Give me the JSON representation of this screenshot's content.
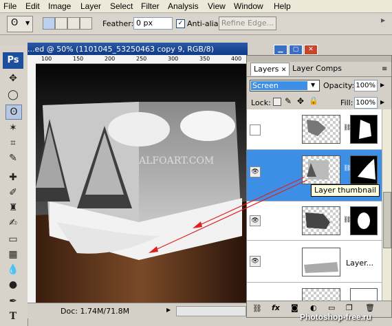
{
  "menu": [
    "File",
    "Edit",
    "Image",
    "Layer",
    "Select",
    "Filter",
    "Analysis",
    "View",
    "Window",
    "Help"
  ],
  "options": {
    "feather_label": "Feather:",
    "feather_value": "0 px",
    "antialias_label": "Anti-alias",
    "refine_edge_label": "Refine Edge..."
  },
  "tools": {
    "ps_logo": "Ps"
  },
  "document": {
    "title": "...ed @ 50% (1101045_53250463 copy 9, RGB/8)",
    "ruler_ticks": [
      "100",
      "150",
      "200",
      "250",
      "300",
      "350",
      "400"
    ],
    "doc_size": "Doc: 1.74M/71.8M",
    "image_watermark": "ALFOART.COM"
  },
  "layers_panel": {
    "tabs": [
      "Layers",
      "Layer Comps"
    ],
    "blend_mode": "Screen",
    "opacity_label": "Opacity:",
    "opacity_value": "100%",
    "lock_label": "Lock:",
    "fill_label": "Fill:",
    "fill_value": "100%",
    "layer_label": "Layer...",
    "tooltip": "Layer thumbnail"
  },
  "watermark": "Photoshop-free.ru",
  "colors": {
    "selection": "#3d8fe6",
    "title_bar": "#0f3a87",
    "arrow": "#e02020"
  }
}
